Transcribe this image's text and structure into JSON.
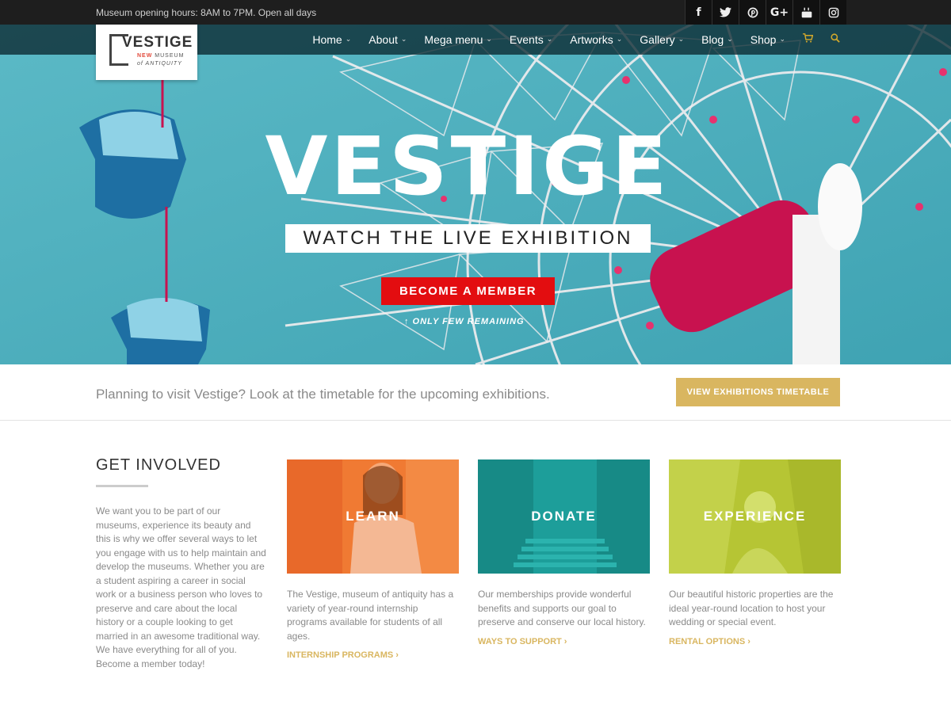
{
  "topbar": {
    "hours": "Museum opening hours: 8AM to 7PM. Open all days",
    "social": [
      "f",
      "t",
      "p",
      "G+",
      "yt",
      "ig"
    ]
  },
  "logo": {
    "name": "VESTIGE",
    "line2_accent": "NEW",
    "line2": "MUSEUM",
    "line3": "of ANTIQUITY"
  },
  "nav": {
    "items": [
      "Home",
      "About",
      "Mega menu",
      "Events",
      "Artworks",
      "Gallery",
      "Blog",
      "Shop"
    ],
    "cart_icon": "cart-icon",
    "search_icon": "search-icon"
  },
  "hero": {
    "title": "VESTIGE",
    "subtitle": "WATCH THE LIVE EXHIBITION",
    "button": "BECOME A MEMBER",
    "note": "↑ ONLY FEW REMAINING"
  },
  "plan": {
    "text": "Planning to visit Vestige? Look at the timetable for the upcoming exhibitions.",
    "button": "VIEW EXHIBITIONS TIMETABLE"
  },
  "involved": {
    "title": "GET INVOLVED",
    "text": "We want you to be part of our museums, experience its beauty and this is why we offer several ways to let you engage with us to help maintain and develop the museums. Whether you are a student aspiring a career in social work or a business person who loves to preserve and care about the local history or a couple looking to get married in an awesome traditional way. We have everything for all of you. Become a member today!"
  },
  "cards": [
    {
      "label": "LEARN",
      "desc": "The Vestige, museum of antiquity has a variety of year-round internship programs available for students of all ages.",
      "link": "INTERNSHIP PROGRAMS ›"
    },
    {
      "label": "DONATE",
      "desc": "Our memberships provide wonderful benefits and supports our goal to preserve and conserve our local history.",
      "link": "WAYS TO SUPPORT ›"
    },
    {
      "label": "EXPERIENCE",
      "desc": "Our beautiful historic properties are the ideal year-round location to host your wedding or special event.",
      "link": "RENTAL OPTIONS ›"
    }
  ],
  "colors": {
    "accent_gold": "#d9b660",
    "button_red": "#e30d10",
    "learn_tint": "#f07a33",
    "donate_tint": "#1d9e9a",
    "experience_tint": "#b6c534"
  }
}
